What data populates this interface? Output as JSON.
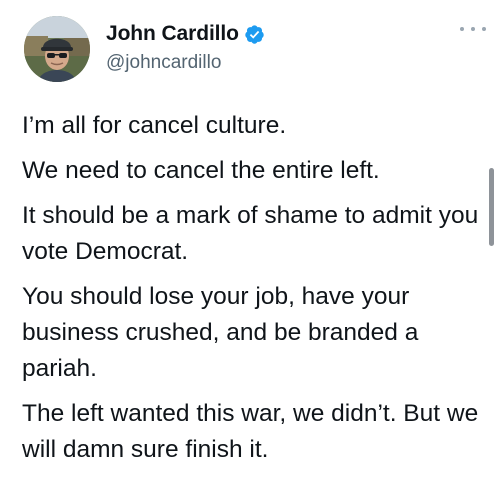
{
  "author": {
    "display_name": "John Cardillo",
    "handle": "@johncardillo",
    "verified": true,
    "avatar_icon": "user-avatar"
  },
  "tweet": {
    "paragraphs": [
      "I’m all for cancel culture.",
      "We need to cancel the entire left.",
      "It should be a mark of shame to admit you vote Democrat.",
      "You should lose your job, have your business crushed, and be branded a pariah.",
      "The left wanted this war, we didn’t. But we will damn sure finish it."
    ]
  },
  "colors": {
    "text": "#0f1419",
    "secondary_text": "#536471",
    "verified_badge": "#1d9bf0"
  },
  "icons": {
    "more": "more-horizontal-icon",
    "verified": "verified-badge-icon"
  }
}
